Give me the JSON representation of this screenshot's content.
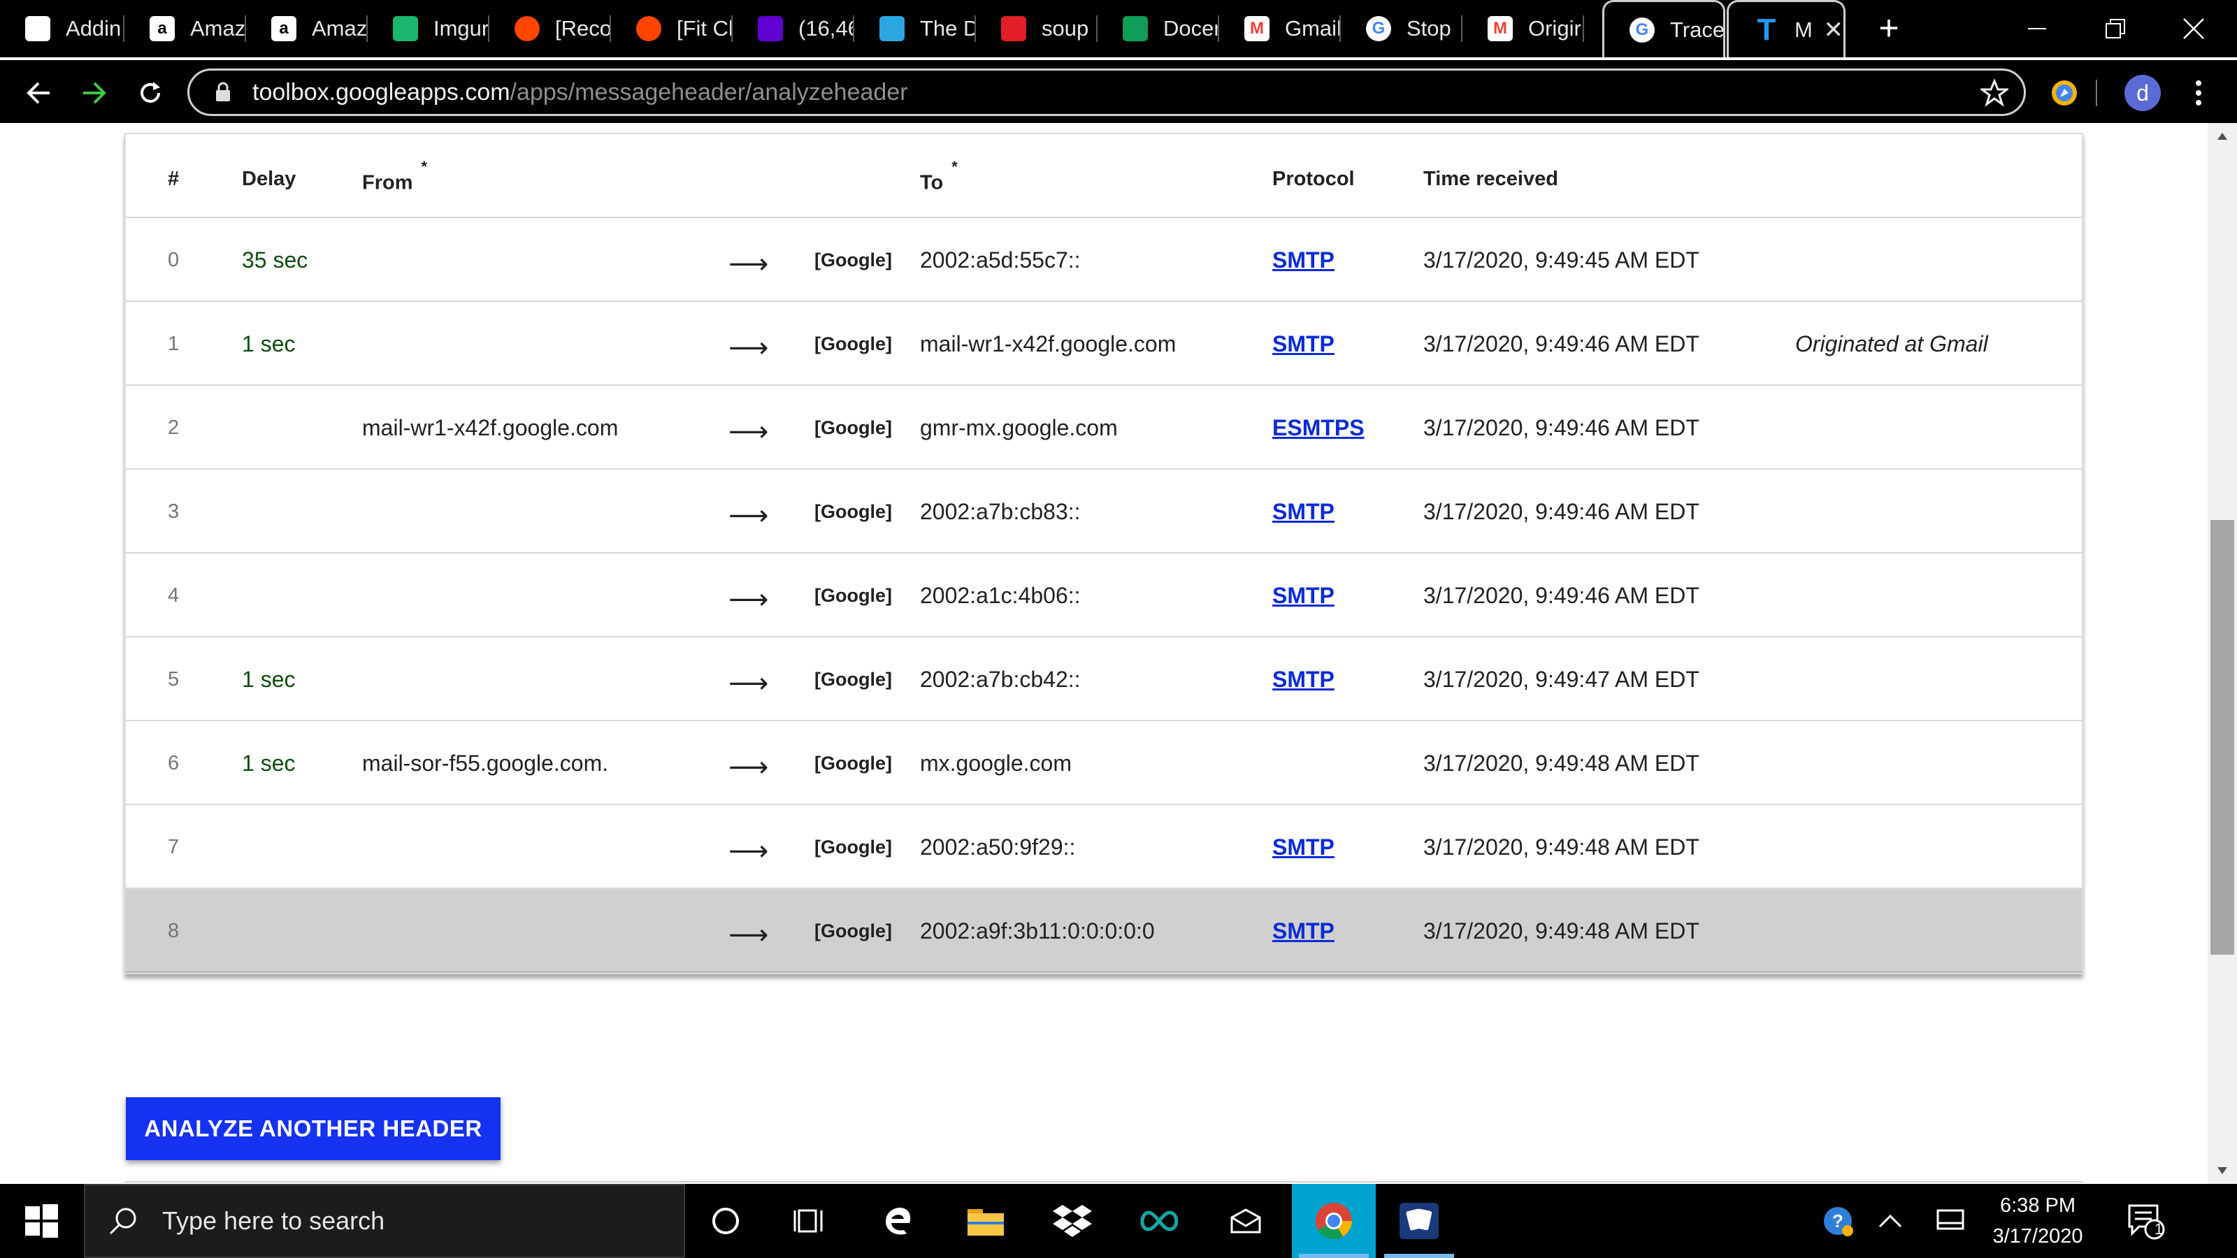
{
  "browser": {
    "tabs": [
      {
        "title": "Addin",
        "icon": "addin-icon",
        "color": "#ffffff"
      },
      {
        "title": "Amaz",
        "icon": "amazon-icon",
        "color": "#ffffff"
      },
      {
        "title": "Amaz",
        "icon": "amazon-icon",
        "color": "#ffffff"
      },
      {
        "title": "Imgur",
        "icon": "imgur-icon",
        "color": "#1bb76e"
      },
      {
        "title": "[Reco",
        "icon": "reddit-icon",
        "color": "#ff4500"
      },
      {
        "title": "[Fit Cl",
        "icon": "reddit-icon",
        "color": "#ff4500"
      },
      {
        "title": "(16,46",
        "icon": "yahoo-mail-icon",
        "color": "#6001d2"
      },
      {
        "title": "The D",
        "icon": "the-d-icon",
        "color": "#2aa7e0"
      },
      {
        "title": "soup",
        "icon": "soup-icon",
        "color": "#e21f26"
      },
      {
        "title": "Docer",
        "icon": "docs-icon",
        "color": "#0f9d58"
      },
      {
        "title": "Gmail",
        "icon": "gmail-icon",
        "color": "#ea4335"
      },
      {
        "title": "Stop",
        "icon": "google-icon",
        "color": "#4285f4"
      },
      {
        "title": "Origir",
        "icon": "gmail-icon",
        "color": "#ea4335"
      },
      {
        "title": "Trace",
        "icon": "google-icon",
        "color": "#4285f4"
      },
      {
        "title": "M",
        "icon": "toolbox-icon",
        "color": "#2196f3"
      }
    ],
    "url_host": "toolbox.googleapps.com",
    "url_path": "/apps/messageheader/analyzeheader",
    "profile_initial": "d"
  },
  "table": {
    "headers": {
      "num": "#",
      "delay": "Delay",
      "from": "From",
      "from_mark": "*",
      "to": "To",
      "to_mark": "*",
      "protocol": "Protocol",
      "time": "Time received"
    },
    "rows": [
      {
        "num": "0",
        "delay": "35 sec",
        "from": "",
        "by": "[Google]",
        "to": "2002:a5d:55c7::",
        "protocol": "SMTP",
        "time": "3/17/2020, 9:49:45 AM EDT",
        "note": ""
      },
      {
        "num": "1",
        "delay": "1 sec",
        "from": "",
        "by": "[Google]",
        "to": "mail-wr1-x42f.google.com",
        "protocol": "SMTP",
        "time": "3/17/2020, 9:49:46 AM EDT",
        "note": "Originated at Gmail"
      },
      {
        "num": "2",
        "delay": "",
        "from": "mail-wr1-x42f.google.com",
        "by": "[Google]",
        "to": "gmr-mx.google.com",
        "protocol": "ESMTPS",
        "time": "3/17/2020, 9:49:46 AM EDT",
        "note": ""
      },
      {
        "num": "3",
        "delay": "",
        "from": "",
        "by": "[Google]",
        "to": "2002:a7b:cb83::",
        "protocol": "SMTP",
        "time": "3/17/2020, 9:49:46 AM EDT",
        "note": ""
      },
      {
        "num": "4",
        "delay": "",
        "from": "",
        "by": "[Google]",
        "to": "2002:a1c:4b06::",
        "protocol": "SMTP",
        "time": "3/17/2020, 9:49:46 AM EDT",
        "note": ""
      },
      {
        "num": "5",
        "delay": "1 sec",
        "from": "",
        "by": "[Google]",
        "to": "2002:a7b:cb42::",
        "protocol": "SMTP",
        "time": "3/17/2020, 9:49:47 AM EDT",
        "note": ""
      },
      {
        "num": "6",
        "delay": "1 sec",
        "from": "mail-sor-f55.google.com.",
        "by": "[Google]",
        "to": "mx.google.com",
        "protocol": "",
        "time": "3/17/2020, 9:49:48 AM EDT",
        "note": ""
      },
      {
        "num": "7",
        "delay": "",
        "from": "",
        "by": "[Google]",
        "to": "2002:a50:9f29::",
        "protocol": "SMTP",
        "time": "3/17/2020, 9:49:48 AM EDT",
        "note": ""
      },
      {
        "num": "8",
        "delay": "",
        "from": "",
        "by": "[Google]",
        "to": "2002:a9f:3b11:0:0:0:0:0",
        "protocol": "SMTP",
        "time": "3/17/2020, 9:49:48 AM EDT",
        "note": "",
        "selected": true
      }
    ],
    "arrow": "⟶"
  },
  "actions": {
    "analyze_another": "ANALYZE ANOTHER HEADER"
  },
  "taskbar": {
    "search_placeholder": "Type here to search",
    "time": "6:38 PM",
    "date": "3/17/2020",
    "notification_count": "1"
  },
  "colors": {
    "accent_button": "#1432f0",
    "link": "#0a2bd6",
    "delay_text": "#0d4d0d",
    "selected_row": "#d0d0d0"
  }
}
